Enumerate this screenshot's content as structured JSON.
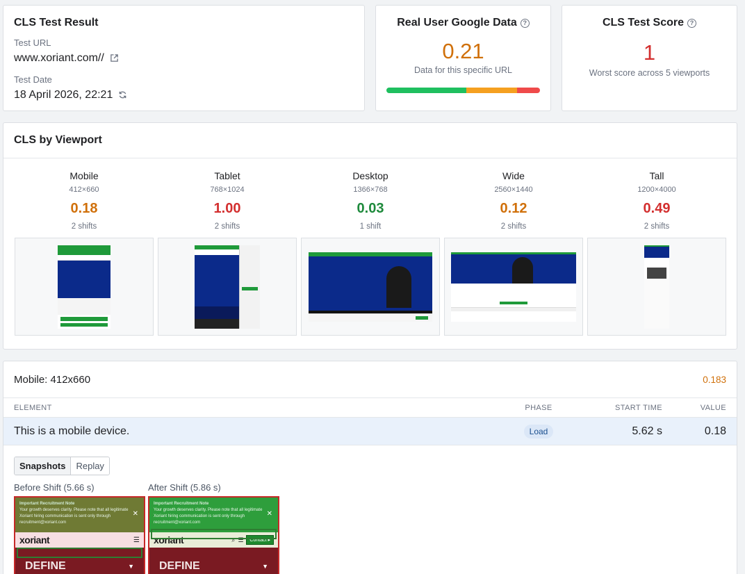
{
  "result": {
    "title": "CLS Test Result",
    "url_label": "Test URL",
    "url": "www.xoriant.com//",
    "date_label": "Test Date",
    "date": "18 April 2026, 22:21"
  },
  "rum": {
    "title": "Real User Google Data",
    "value": "0.21",
    "subtitle": "Data for this specific URL",
    "distribution": [
      0.52,
      0.33,
      0.15
    ],
    "colors": [
      "#1fbf5f",
      "#f5a020",
      "#ef4a4a"
    ]
  },
  "score": {
    "title": "CLS Test Score",
    "value": "1",
    "subtitle": "Worst score across 5 viewports"
  },
  "viewport": {
    "title": "CLS by Viewport",
    "items": [
      {
        "name": "Mobile",
        "size": "412×660",
        "score": "0.18",
        "shifts": "2 shifts",
        "color": "#d0700a"
      },
      {
        "name": "Tablet",
        "size": "768×1024",
        "score": "1.00",
        "shifts": "2 shifts",
        "color": "#d32f2f"
      },
      {
        "name": "Desktop",
        "size": "1366×768",
        "score": "0.03",
        "shifts": "1 shift",
        "color": "#1e8a3c"
      },
      {
        "name": "Wide",
        "size": "2560×1440",
        "score": "0.12",
        "shifts": "2 shifts",
        "color": "#d0700a"
      },
      {
        "name": "Tall",
        "size": "1200×4000",
        "score": "0.49",
        "shifts": "2 shifts",
        "color": "#d32f2f"
      }
    ]
  },
  "mobile": {
    "title": "Mobile: 412x660",
    "score": "0.183",
    "columns": {
      "element": "ELEMENT",
      "phase": "PHASE",
      "start": "START TIME",
      "value": "VALUE"
    },
    "row": {
      "element": "This is a mobile device.",
      "phase": "Load",
      "start": "5.62 s",
      "value": "0.18"
    },
    "tabs": {
      "snapshots": "Snapshots",
      "replay": "Replay"
    },
    "before_label": "Before Shift (5.66 s)",
    "after_label": "After Shift (5.86 s)",
    "snapshot": {
      "note_title": "Important Recruitment Note",
      "note_line1": "Your growth deserves clarity. Please note that all legitimate",
      "note_line2": "Xoriant hiring communication is sent only through",
      "note_line3": "recruitment@xoriant.com",
      "logo": "xoriant",
      "hero_word": "DEFINE",
      "contact": "Contact ▸"
    }
  }
}
